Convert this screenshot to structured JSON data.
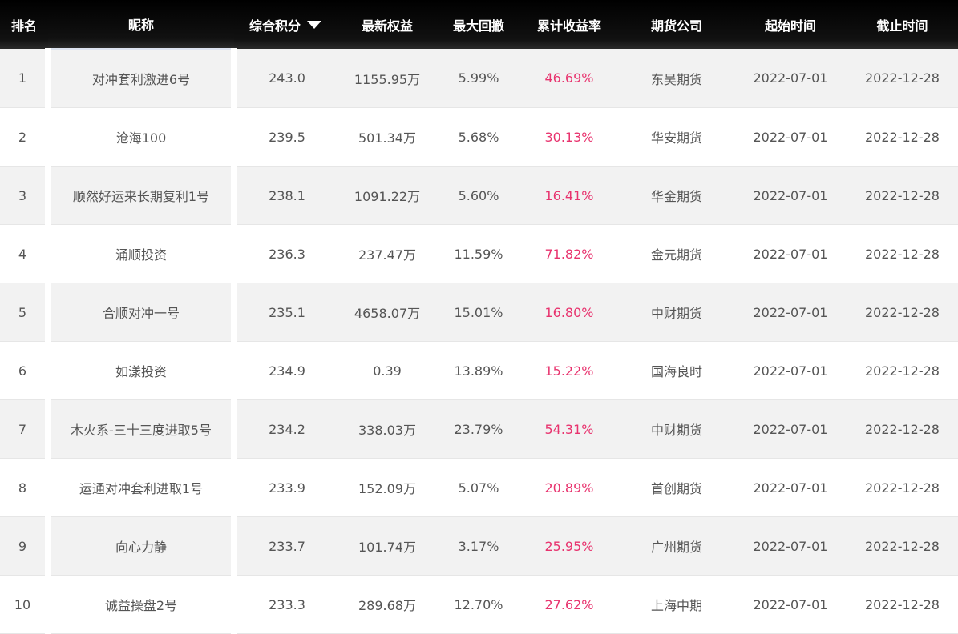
{
  "columns": [
    "排名",
    "昵称",
    "综合积分",
    "最新权益",
    "最大回撤",
    "累计收益率",
    "期货公司",
    "起始时间",
    "截止时间"
  ],
  "sort": {
    "column": "综合积分",
    "direction": "desc"
  },
  "colors": {
    "header_bg": "#000000",
    "header_text": "#ffffff",
    "row_alt": "#f2f2f2",
    "return_text": "#e8336e",
    "cell_text": "#555555"
  },
  "rows": [
    {
      "rank": "1",
      "name": "对冲套利激进6号",
      "score": "243.0",
      "equity": "1155.95万",
      "drawdown": "5.99%",
      "return": "46.69%",
      "company": "东吴期货",
      "start": "2022-07-01",
      "end": "2022-12-28"
    },
    {
      "rank": "2",
      "name": "沧海100",
      "score": "239.5",
      "equity": "501.34万",
      "drawdown": "5.68%",
      "return": "30.13%",
      "company": "华安期货",
      "start": "2022-07-01",
      "end": "2022-12-28"
    },
    {
      "rank": "3",
      "name": "顺然好运来长期复利1号",
      "score": "238.1",
      "equity": "1091.22万",
      "drawdown": "5.60%",
      "return": "16.41%",
      "company": "华金期货",
      "start": "2022-07-01",
      "end": "2022-12-28"
    },
    {
      "rank": "4",
      "name": "涌顺投资",
      "score": "236.3",
      "equity": "237.47万",
      "drawdown": "11.59%",
      "return": "71.82%",
      "company": "金元期货",
      "start": "2022-07-01",
      "end": "2022-12-28"
    },
    {
      "rank": "5",
      "name": "合顺对冲一号",
      "score": "235.1",
      "equity": "4658.07万",
      "drawdown": "15.01%",
      "return": "16.80%",
      "company": "中财期货",
      "start": "2022-07-01",
      "end": "2022-12-28"
    },
    {
      "rank": "6",
      "name": "如漾投资",
      "score": "234.9",
      "equity": "0.39",
      "drawdown": "13.89%",
      "return": "15.22%",
      "company": "国海良时",
      "start": "2022-07-01",
      "end": "2022-12-28"
    },
    {
      "rank": "7",
      "name": "木火系-三十三度进取5号",
      "score": "234.2",
      "equity": "338.03万",
      "drawdown": "23.79%",
      "return": "54.31%",
      "company": "中财期货",
      "start": "2022-07-01",
      "end": "2022-12-28"
    },
    {
      "rank": "8",
      "name": "运通对冲套利进取1号",
      "score": "233.9",
      "equity": "152.09万",
      "drawdown": "5.07%",
      "return": "20.89%",
      "company": "首创期货",
      "start": "2022-07-01",
      "end": "2022-12-28"
    },
    {
      "rank": "9",
      "name": "向心力静",
      "score": "233.7",
      "equity": "101.74万",
      "drawdown": "3.17%",
      "return": "25.95%",
      "company": "广州期货",
      "start": "2022-07-01",
      "end": "2022-12-28"
    },
    {
      "rank": "10",
      "name": "诚益操盘2号",
      "score": "233.3",
      "equity": "289.68万",
      "drawdown": "12.70%",
      "return": "27.62%",
      "company": "上海中期",
      "start": "2022-07-01",
      "end": "2022-12-28"
    }
  ]
}
